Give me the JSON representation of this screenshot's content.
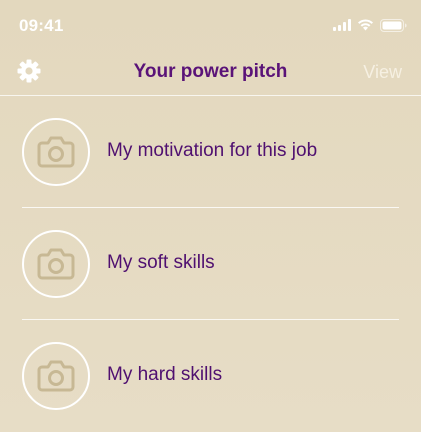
{
  "status_bar": {
    "time": "09:41"
  },
  "nav": {
    "title": "Your power pitch",
    "view_label": "View",
    "settings_icon": "gear-icon"
  },
  "items": [
    {
      "label": "My motivation for this job",
      "icon": "camera-icon"
    },
    {
      "label": "My soft skills",
      "icon": "camera-icon"
    },
    {
      "label": "My hard skills",
      "icon": "camera-icon"
    }
  ],
  "colors": {
    "background": "#e6dcc3",
    "title": "#5a1378",
    "label": "#4f1070",
    "icon": "#c7b894",
    "accent_white": "#ffffff"
  }
}
